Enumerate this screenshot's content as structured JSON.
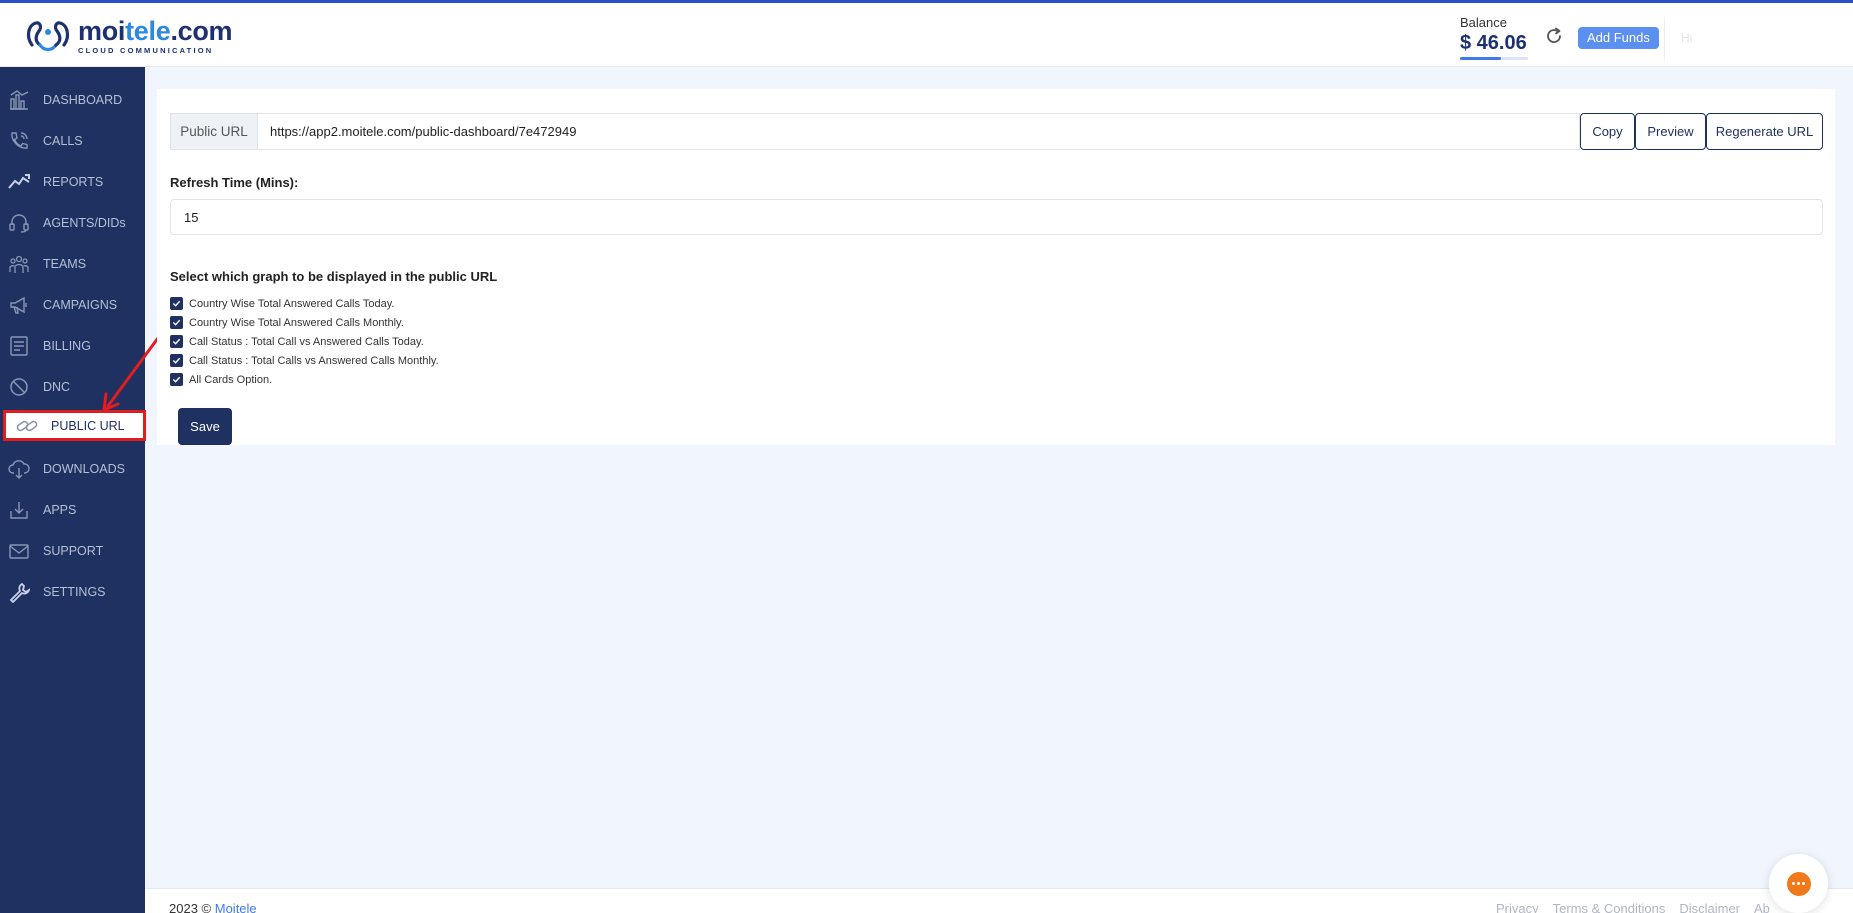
{
  "header": {
    "logo_name_part1": "moi",
    "logo_name_part2": "tele",
    "logo_name_part3": ".com",
    "logo_subtitle": "CLOUD COMMUNICATION",
    "balance_label": "Balance",
    "balance_value": "$ 46.06",
    "add_funds_label": "Add Funds",
    "user_greeting": "Hi"
  },
  "sidebar": {
    "items": [
      {
        "label": "DASHBOARD",
        "icon": "dashboard-icon"
      },
      {
        "label": "CALLS",
        "icon": "phone-icon"
      },
      {
        "label": "REPORTS",
        "icon": "chart-line-icon"
      },
      {
        "label": "AGENTS/DIDs",
        "icon": "headset-icon"
      },
      {
        "label": "TEAMS",
        "icon": "team-icon"
      },
      {
        "label": "CAMPAIGNS",
        "icon": "megaphone-icon"
      },
      {
        "label": "BILLING",
        "icon": "billing-icon"
      },
      {
        "label": "DNC",
        "icon": "ban-icon"
      },
      {
        "label": "PUBLIC URL",
        "icon": "link-icon",
        "active": true
      },
      {
        "label": "DOWNLOADS",
        "icon": "cloud-download-icon"
      },
      {
        "label": "APPS",
        "icon": "download-tray-icon"
      },
      {
        "label": "SUPPORT",
        "icon": "envelope-icon"
      },
      {
        "label": "SETTINGS",
        "icon": "wrench-icon"
      }
    ]
  },
  "main": {
    "public_url_label": "Public URL",
    "public_url_value": "https://app2.moitele.com/public-dashboard/7e472949",
    "copy_label": "Copy",
    "preview_label": "Preview",
    "regenerate_label": "Regenerate URL",
    "refresh_label": "Refresh Time (Mins):",
    "refresh_value": "15",
    "select_label": "Select which graph to be displayed in the public URL",
    "options": [
      {
        "label": "Country Wise Total Answered Calls Today.",
        "checked": true
      },
      {
        "label": "Country Wise Total Answered Calls Monthly.",
        "checked": true
      },
      {
        "label": "Call Status : Total Call vs Answered Calls Today.",
        "checked": true
      },
      {
        "label": "Call Status : Total Calls vs Answered Calls Monthly.",
        "checked": true
      },
      {
        "label": "All Cards Option.",
        "checked": true
      }
    ],
    "save_label": "Save"
  },
  "footer": {
    "copyright_prefix": "2023 ©",
    "copyright_link": "Moitele",
    "links": [
      "Privacy",
      "Terms & Conditions",
      "Disclaimer",
      "Ab"
    ]
  },
  "colors": {
    "sidebar_bg": "#1f3160",
    "accent": "#5b8ff0",
    "highlight_box": "#e11d20",
    "chat_orange": "#f07a1a"
  }
}
